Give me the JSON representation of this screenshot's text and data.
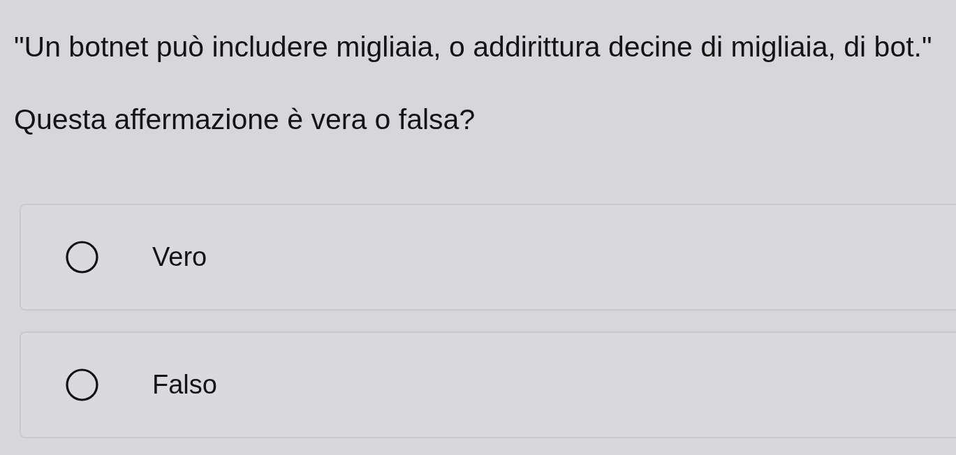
{
  "question": {
    "statement": "\"Un botnet può includere migliaia, o addirittura decine di migliaia, di bot.\"",
    "prompt": "Questa affermazione è vera o falsa?"
  },
  "options": [
    {
      "label": "Vero",
      "selected": false
    },
    {
      "label": "Falso",
      "selected": false
    }
  ]
}
